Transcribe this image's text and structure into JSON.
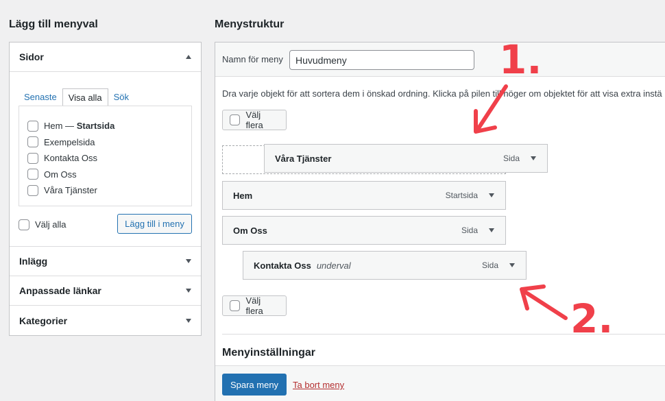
{
  "left": {
    "heading": "Lägg till menyval",
    "pages_section": {
      "title": "Sidor",
      "tabs": [
        "Senaste",
        "Visa alla",
        "Sök"
      ],
      "items": [
        {
          "label": "Hem —",
          "bold_suffix": "Startsida"
        },
        {
          "label": "Exempelsida"
        },
        {
          "label": "Kontakta Oss"
        },
        {
          "label": "Om Oss"
        },
        {
          "label": "Våra Tjänster"
        }
      ],
      "select_all": "Välj alla",
      "add_button": "Lägg till i meny"
    },
    "sections": [
      "Inlägg",
      "Anpassade länkar",
      "Kategorier"
    ]
  },
  "right": {
    "heading": "Menystruktur",
    "menu_name_label": "Namn för meny",
    "menu_name_value": "Huvudmeny",
    "instruction": "Dra varje objekt för att sortera dem i önskad ordning. Klicka på pilen till höger om objektet för att visa extra instä",
    "select_multiple": "Välj flera",
    "menu_items": [
      {
        "title": "Våra Tjänster",
        "type": "Sida"
      },
      {
        "title": "Hem",
        "type": "Startsida"
      },
      {
        "title": "Om Oss",
        "type": "Sida"
      },
      {
        "title": "Kontakta Oss",
        "sub": "underval",
        "type": "Sida"
      }
    ],
    "settings_heading": "Menyinställningar",
    "save_button": "Spara meny",
    "delete_link": "Ta bort meny"
  },
  "annotations": {
    "one": "1.",
    "two": "2.",
    "color": "#f0404a"
  },
  "colors": {
    "primary": "#2271b1",
    "link": "#2271b1",
    "delete": "#b32d2e",
    "bg": "#f0f0f1"
  }
}
